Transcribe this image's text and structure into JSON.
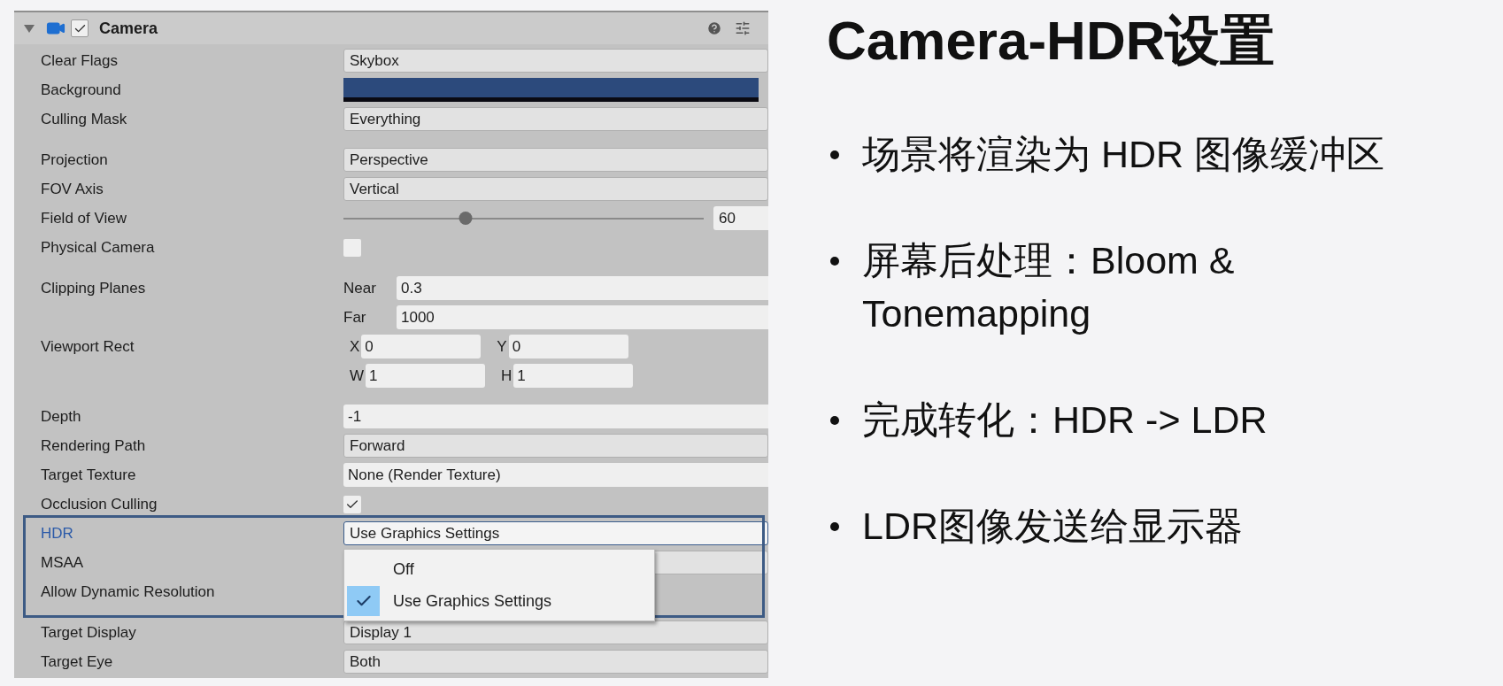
{
  "component": {
    "title": "Camera",
    "enabled": true,
    "expanded": true
  },
  "groups": [
    {
      "rows": [
        {
          "label": "Clear Flags",
          "kind": "dropdown",
          "value": "Skybox",
          "focused": false
        },
        {
          "label": "Background",
          "kind": "color",
          "color": "#2c4a7c",
          "focused": false
        },
        {
          "label": "Culling Mask",
          "kind": "dropdown",
          "value": "Everything",
          "focused": false
        }
      ]
    },
    {
      "rows": [
        {
          "label": "Projection",
          "kind": "dropdown",
          "value": "Perspective",
          "focused": false
        },
        {
          "label": "FOV Axis",
          "kind": "dropdown",
          "value": "Vertical",
          "focused": false
        },
        {
          "label": "Field of View",
          "kind": "slider",
          "level": 0.34,
          "value": "60",
          "focused": false
        },
        {
          "label": "Physical Camera",
          "kind": "checkbox",
          "checked": false,
          "focused": false
        }
      ]
    },
    {
      "rows": [
        {
          "label": "Clipping Planes",
          "kind": "plane",
          "fields": [
            {
              "label": "Near",
              "value": "0.3"
            }
          ],
          "focused": false
        },
        {
          "kind": "plane",
          "fields": [
            {
              "label": "Far",
              "value": "1000"
            }
          ]
        },
        {
          "label": "Viewport Rect",
          "kind": "vector",
          "fields": [
            {
              "label": "X",
              "value": "0"
            },
            {
              "label": "Y",
              "value": "0"
            }
          ],
          "focused": false
        },
        {
          "kind": "vector",
          "fields": [
            {
              "label": "W",
              "value": "1"
            },
            {
              "label": "H",
              "value": "1"
            }
          ]
        }
      ]
    },
    {
      "rows": [
        {
          "label": "Depth",
          "kind": "field",
          "value": "-1",
          "focused": false
        },
        {
          "label": "Rendering Path",
          "kind": "dropdown",
          "value": "Forward",
          "focused": false
        },
        {
          "label": "Target Texture",
          "kind": "field",
          "value": "None (Render Texture)",
          "focused": false
        },
        {
          "label": "Occlusion Culling",
          "kind": "checkbox",
          "checked": true,
          "focused": false
        },
        {
          "label": "HDR",
          "kind": "dropdown",
          "value": "Use Graphics Settings",
          "focused": true,
          "popup": {
            "options": [
              {
                "label": "Off",
                "selected": false
              },
              {
                "label": "Use Graphics Settings",
                "selected": true
              }
            ]
          }
        },
        {
          "label": "MSAA",
          "kind": "dropdown",
          "focused": false
        },
        {
          "label": "Allow Dynamic Resolution",
          "kind": "covered",
          "focused": false
        }
      ]
    },
    {
      "rows": [
        {
          "label": "Target Display",
          "kind": "dropdown",
          "value": "Display 1",
          "focused": false
        },
        {
          "label": "Target Eye",
          "kind": "dropdown",
          "value": "Both",
          "focused": false
        }
      ]
    }
  ],
  "slide": {
    "title": "Camera-HDR设置",
    "bullets": [
      "场景将渲染为 HDR 图像缓冲区",
      "屏幕后处理：Bloom & Tonemapping",
      "完成转化：HDR -> LDR",
      "LDR图像发送给显示器"
    ]
  }
}
